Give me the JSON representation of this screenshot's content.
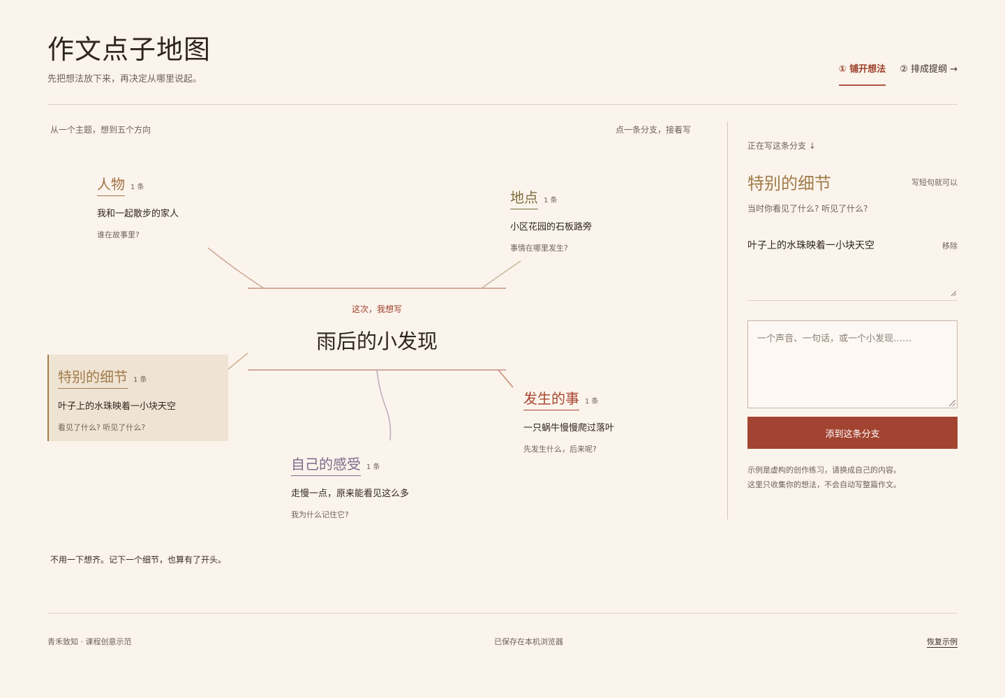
{
  "header": {
    "title": "作文点子地图",
    "subtitle": "先把想法放下来，再决定从哪里说起。",
    "steps": [
      {
        "label": "① 铺开想法",
        "active": true
      },
      {
        "label": "② 排成提纲 →",
        "active": false
      }
    ]
  },
  "map": {
    "hint_left": "从一个主题，想到五个方向",
    "hint_right": "点一条分支，接着写",
    "center": {
      "kicker": "这次，我想写",
      "topic": "雨后的小发现"
    },
    "branches": {
      "person": {
        "title": "人物",
        "count": "1 条",
        "item": "我和一起散步的家人",
        "hint": "谁在故事里?",
        "color": "#a17247"
      },
      "place": {
        "title": "地点",
        "count": "1 条",
        "item": "小区花园的石板路旁",
        "hint": "事情在哪里发生?",
        "color": "#7b6d3d"
      },
      "detail": {
        "title": "特别的细节",
        "count": "1 条",
        "item": "叶子上的水珠映着一小块天空",
        "hint": "看见了什么? 听见了什么?",
        "color": "#a17b4a",
        "selected": true
      },
      "event": {
        "title": "发生的事",
        "count": "1 条",
        "item": "一只蜗牛慢慢爬过落叶",
        "hint": "先发生什么，后来呢?",
        "color": "#a84630"
      },
      "feeling": {
        "title": "自己的感受",
        "count": "1 条",
        "item": "走慢一点，原来能看见这么多",
        "hint": "我为什么记住它?",
        "color": "#7e6a8a"
      }
    },
    "bottom_note": "不用一下想齐。记下一个细节，也算有了开头。"
  },
  "panel": {
    "kicker": "正在写这条分支 ↓",
    "title": "特别的细节",
    "aside": "写短句就可以",
    "prompt": "当时你看见了什么? 听见了什么?",
    "entries": [
      {
        "text": "叶子上的水珠映着一小块天空",
        "remove_label": "移除"
      }
    ],
    "input_placeholder": "一个声音、一句话，或一个小发现……",
    "add_button": "添到这条分支",
    "note_line1": "示例是虚构的创作练习，请换成自己的内容。",
    "note_line2": "这里只收集你的想法，不会自动写整篇作文。"
  },
  "footer": {
    "left": "青禾致知 · 课程创意示范",
    "center": "已保存在本机浏览器",
    "right": "恢复示例"
  },
  "colors": {
    "background": "#fbf4ec",
    "accent": "#a24431",
    "selected_fill": "#efe3d3"
  }
}
